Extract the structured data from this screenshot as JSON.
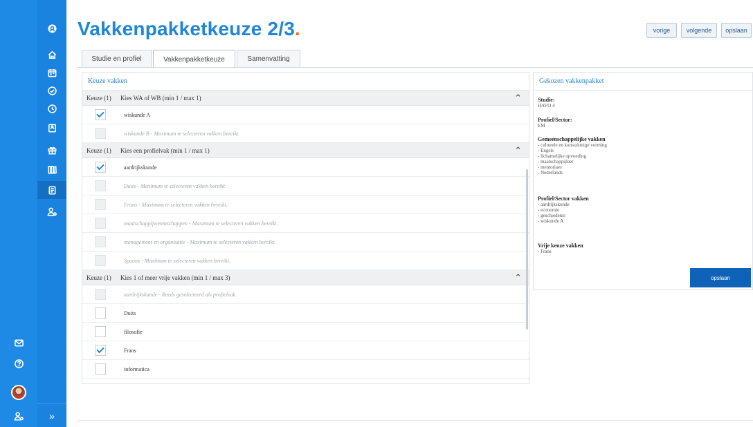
{
  "header": {
    "title": "Vakkenpakketkeuze 2/3",
    "title_dot": ".",
    "buttons": {
      "prev": "vorige",
      "next": "volgende",
      "save": "opslaan"
    }
  },
  "tabs": [
    {
      "label": "Studie en profiel",
      "active": false
    },
    {
      "label": "Vakkenpakketkeuze",
      "active": true
    },
    {
      "label": "Samenvatting",
      "active": false
    }
  ],
  "left_panel": {
    "title": "Keuze vakken",
    "groups": [
      {
        "keuze": "Keuze (1)",
        "name": "Kies WA of WB (min 1 / max 1)",
        "rows": [
          {
            "label": "wiskunde A",
            "state": "checked"
          },
          {
            "label": "wiskunde B - Maximum te selecteren vakken bereikt.",
            "state": "disabled"
          }
        ]
      },
      {
        "keuze": "Keuze (1)",
        "name": "Kies een profielvak (min 1 / max 1)",
        "rows": [
          {
            "label": "aardrijkskunde",
            "state": "checked"
          },
          {
            "label": "Duits - Maximum te selecteren vakken bereikt.",
            "state": "disabled"
          },
          {
            "label": "Frans - Maximum te selecteren vakken bereikt.",
            "state": "disabled"
          },
          {
            "label": "maatschappijwetenschappen - Maximum te selecteren vakken bereikt.",
            "state": "disabled"
          },
          {
            "label": "management en organisatie - Maximum te selecteren vakken bereikt.",
            "state": "disabled"
          },
          {
            "label": "Spaans - Maximum te selecteren vakken bereikt.",
            "state": "disabled"
          }
        ]
      },
      {
        "keuze": "Keuze (1)",
        "name": "Kies 1 of meer vrije vakken (min 1 / max 3)",
        "rows": [
          {
            "label": "aardrijkskunde - Reeds geselecteerd als profielvak.",
            "state": "disabled"
          },
          {
            "label": "Duits",
            "state": "empty"
          },
          {
            "label": "filosofie",
            "state": "empty"
          },
          {
            "label": "Frans",
            "state": "checked"
          },
          {
            "label": "informatica",
            "state": "empty"
          }
        ]
      }
    ]
  },
  "right_panel": {
    "title": "Gekozen vakkenpakket",
    "studie_label": "Studie:",
    "studie_value": "HAVO 4",
    "profiel_label": "Profiel/Sector:",
    "profiel_value": "EM",
    "gemeen_label": "Gemeenschappelijke vakken",
    "gemeen_items": [
      "- culturele en kunstzinnige vorming",
      "- Engels",
      "- lichamelijke opvoeding",
      "- maatschappijleer",
      "- mentoriaes",
      "- Nederlands"
    ],
    "sector_label": "Profiel/Sector vakken",
    "sector_items": [
      "- aardrijkskunde",
      "- economie",
      "- geschiedenis",
      "- wiskunde A"
    ],
    "vrije_label": "Vrije keuze vakken",
    "vrije_items": [
      "- Frans"
    ],
    "save_label": "opslaan"
  },
  "colors": {
    "accent": "#1f86d6",
    "sidebar": "#1a82df",
    "dot": "#f26b21",
    "save": "#0e63b8"
  },
  "nav_icons": [
    "app-logo-icon",
    "home-icon",
    "calendar-icon",
    "check-circle-icon",
    "clock-icon",
    "book-icon",
    "gift-icon",
    "library-icon",
    "document-icon",
    "user-settings-icon"
  ],
  "rail_icons": [
    "mail-icon",
    "help-icon",
    "avatar",
    "user-settings-icon"
  ]
}
